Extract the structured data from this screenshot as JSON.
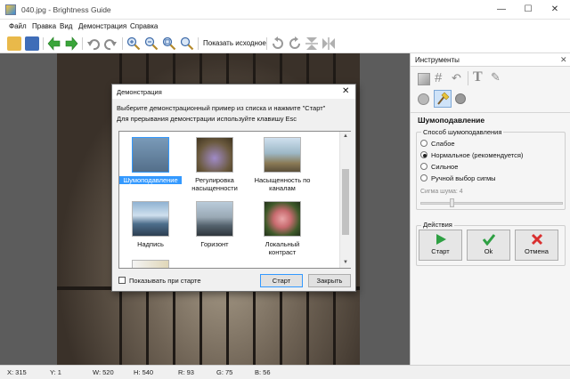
{
  "window": {
    "title": "040.jpg - Brightness Guide",
    "minimize": "—",
    "maximize": "☐",
    "close": "✕"
  },
  "menu": [
    "Файл",
    "Правка",
    "Вид",
    "Демонстрация",
    "Справка"
  ],
  "toolbar": {
    "show_original": "Показать исходное"
  },
  "panel": {
    "title": "Инструменты",
    "tool_title": "Шумоподавление",
    "method_group": "Способ шумоподавления",
    "options": [
      {
        "label": "Слабое",
        "selected": false
      },
      {
        "label": "Нормальное (рекомендуется)",
        "selected": true
      },
      {
        "label": "Сильное",
        "selected": false
      },
      {
        "label": "Ручной выбор сигмы",
        "selected": false
      }
    ],
    "sigma_label": "Сигма шума: 4",
    "actions_group": "Действия",
    "start": "Старт",
    "ok": "Ok",
    "cancel": "Отмена"
  },
  "dialog": {
    "title": "Демонстрация",
    "close": "✕",
    "instruction1": "Выберите демонстрационный пример из списка и нажмите \"Старт\"",
    "instruction2": "Для прерывания демонстрации используйте клавишу Esc",
    "items": [
      {
        "label": "Шумоподавление",
        "selected": true
      },
      {
        "label": "Регулировка насыщенности",
        "selected": false
      },
      {
        "label": "Насыщенность по каналам",
        "selected": false
      },
      {
        "label": "Надпись",
        "selected": false
      },
      {
        "label": "Горизонт",
        "selected": false
      },
      {
        "label": "Локальный контраст",
        "selected": false
      }
    ],
    "show_on_start": "Показывать при старте",
    "start": "Старт",
    "close_button": "Закрыть"
  },
  "status": {
    "x": "X: 315",
    "y": "Y: 1",
    "w": "W: 520",
    "h": "H: 540",
    "r": "R: 93",
    "g": "G: 75",
    "b": "B: 56"
  },
  "colors": {
    "accent_selection": "#3399ff",
    "start_green": "#2ea043",
    "ok_green": "#2ea043",
    "cancel_red": "#d93030"
  }
}
